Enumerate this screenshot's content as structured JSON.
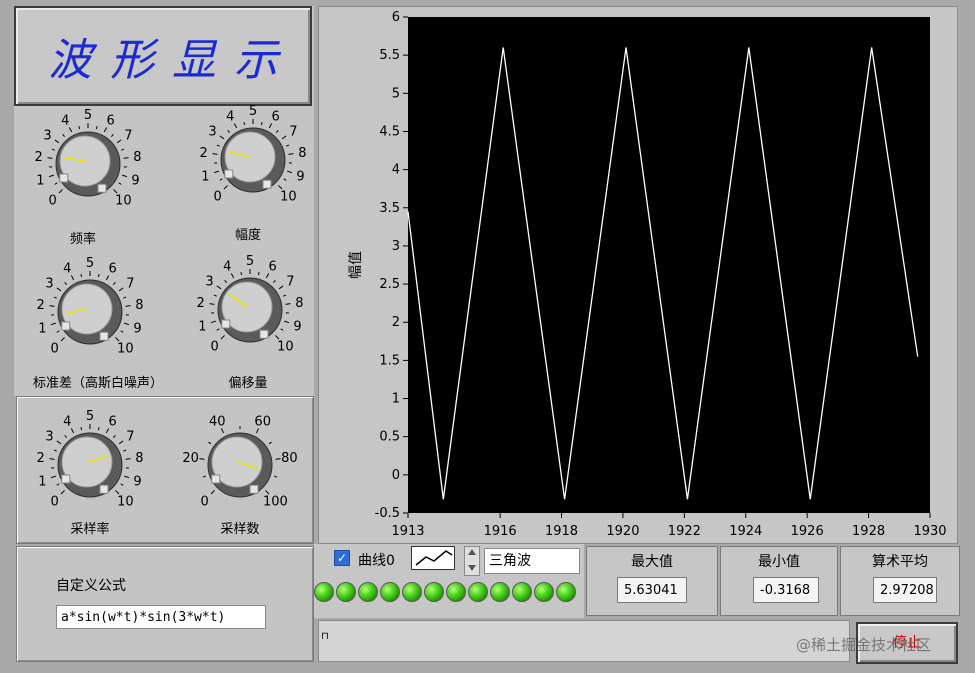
{
  "title": "波形显示",
  "knobs": [
    {
      "label": "频率",
      "ticks": [
        "0",
        "1",
        "2",
        "3",
        "4",
        "5",
        "6",
        "7",
        "8",
        "9",
        "10"
      ],
      "value": 2.0
    },
    {
      "label": "幅度",
      "ticks": [
        "0",
        "1",
        "2",
        "3",
        "4",
        "5",
        "6",
        "7",
        "8",
        "9",
        "10"
      ],
      "value": 2.2
    },
    {
      "label": "标准差（高斯白噪声）",
      "ticks": [
        "0",
        "1",
        "2",
        "3",
        "4",
        "5",
        "6",
        "7",
        "8",
        "9",
        "10"
      ],
      "value": 1.2
    },
    {
      "label": "偏移量",
      "ticks": [
        "0",
        "1",
        "2",
        "3",
        "4",
        "5",
        "6",
        "7",
        "8",
        "9",
        "10"
      ],
      "value": 3.0
    },
    {
      "label": "采样率",
      "ticks": [
        "0",
        "1",
        "2",
        "3",
        "4",
        "5",
        "6",
        "7",
        "8",
        "9",
        "10"
      ],
      "value": 7.8
    },
    {
      "label": "采样数",
      "ticks": [
        "0",
        "20",
        "40",
        "60",
        "80",
        "100"
      ],
      "value": 90
    }
  ],
  "formula": {
    "label": "自定义公式",
    "value": "a*sin(w*t)*sin(3*w*t)"
  },
  "legend": {
    "checkbox_label": "曲线0",
    "checked": true
  },
  "wave_select": {
    "value": "三角波"
  },
  "stats": {
    "max_label": "最大值",
    "max_value": "5.63041",
    "min_label": "最小值",
    "min_value": "-0.3168",
    "mean_label": "算术平均",
    "mean_value": "2.97208"
  },
  "leds": {
    "count": 12,
    "color": "#35c414"
  },
  "stop_button": {
    "label": "停止"
  },
  "watermark": "@稀土掘金技术社区",
  "chart_data": {
    "type": "line",
    "ylabel": "幅值",
    "xlim": [
      1913,
      1930
    ],
    "ylim": [
      -0.5,
      6
    ],
    "x_ticks": [
      "1913",
      "1916",
      "1918",
      "1920",
      "1922",
      "1924",
      "1926",
      "1928",
      "1930"
    ],
    "y_ticks": [
      "-0.5",
      "0",
      "0.5",
      "1",
      "1.5",
      "2",
      "2.5",
      "3",
      "3.5",
      "4",
      "4.5",
      "5",
      "5.5",
      "6"
    ],
    "series": [
      {
        "color": "#ffffff",
        "x": [
          1913.0,
          1914.15,
          1916.1,
          1918.1,
          1920.1,
          1922.1,
          1924.1,
          1926.1,
          1928.1,
          1929.6
        ],
        "y": [
          3.45,
          -0.32,
          5.6,
          -0.32,
          5.6,
          -0.32,
          5.6,
          -0.32,
          5.6,
          1.55
        ]
      }
    ],
    "plot_bg": "#000000"
  }
}
